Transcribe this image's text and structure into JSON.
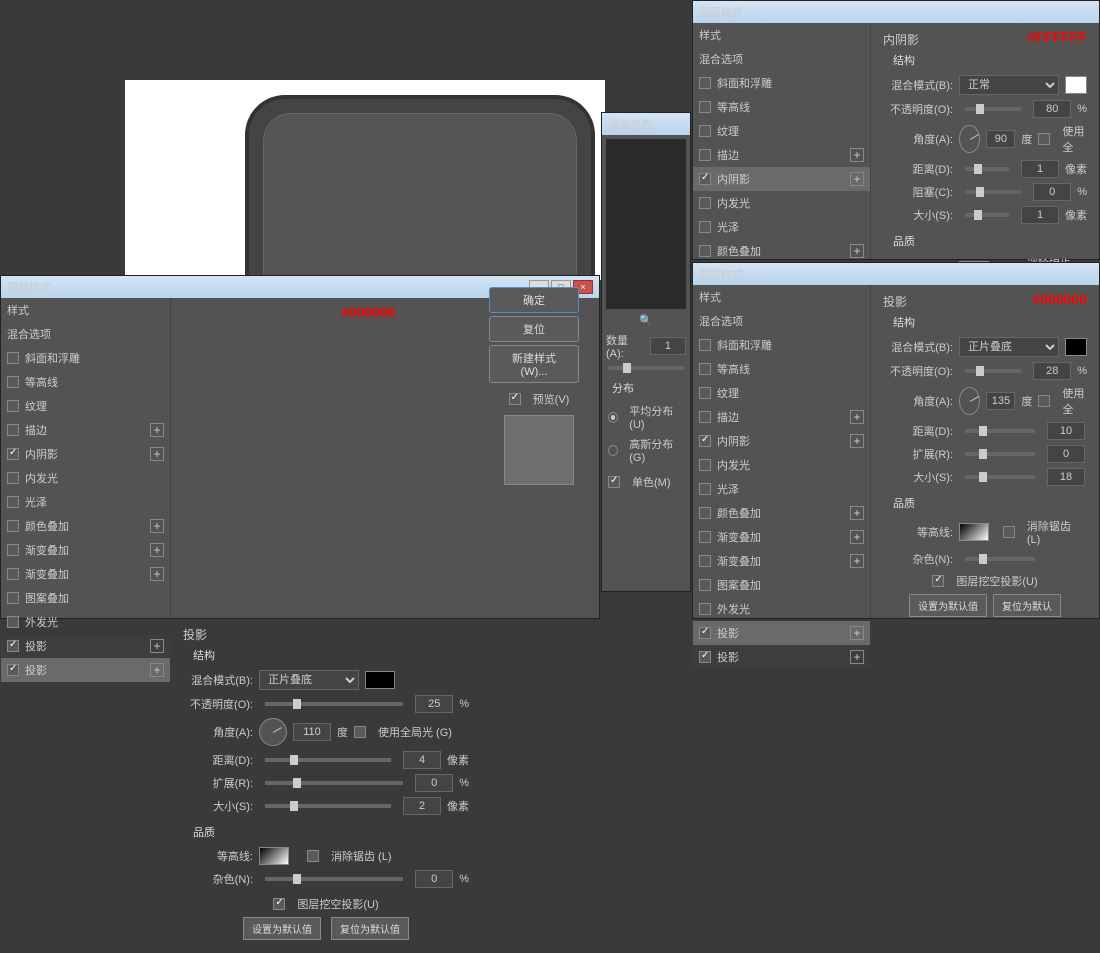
{
  "dialogTitle": "图层样式",
  "addColor": {
    "title": "添加杂色",
    "qty": "数量(A):",
    "qtyVal": "1",
    "dist": "分布",
    "even": "平均分布(U)",
    "gauss": "高斯分布(G)",
    "mono": "单色(M)"
  },
  "styles": {
    "header": "样式",
    "blend": "混合选项",
    "bevel": "斜面和浮雕",
    "contourRow": "等高线",
    "texture": "纹理",
    "stroke": "描边",
    "innerShadow": "内阴影",
    "innerGlow": "内发光",
    "satin": "光泽",
    "colorOverlay": "颜色叠加",
    "gradOverlay": "渐变叠加",
    "patOverlay": "图案叠加",
    "outerGlow": "外发光",
    "dropShadow": "投影",
    "dropShadow2": "投影"
  },
  "struct": {
    "title": "结构",
    "blendMode": "混合模式(B):",
    "multiply": "正片叠底",
    "normal": "正常",
    "opacity": "不透明度(O):",
    "angle": "角度(A):",
    "deg": "度",
    "useGlobal": "使用全局光 (G)",
    "useGlobalShort": "使用全",
    "distance": "距离(D):",
    "spread": "扩展(R):",
    "choke": "阻塞(C):",
    "size": "大小(S):",
    "px": "像素",
    "pct": "%"
  },
  "quality": {
    "title": "品质",
    "contour": "等高线:",
    "anti": "消除锯齿 (L)",
    "noise": "杂色(N):"
  },
  "knockout": "图层挖空投影(U)",
  "defaults": {
    "set": "设置为默认值",
    "reset": "复位为默认值",
    "resetShort": "复位为默认"
  },
  "btns": {
    "ok": "确定",
    "cancel": "复位",
    "newStyle": "新建样式 (W)...",
    "preview": "预览(V)"
  },
  "vals": {
    "left": {
      "title": "投影",
      "annot": "#000000",
      "opacity": "25",
      "angle": "110",
      "dist": "4",
      "spread": "0",
      "size": "2",
      "noise": "0"
    },
    "right1": {
      "title": "内阴影",
      "annot": "#FFFFFF",
      "opacity": "80",
      "angle": "90",
      "dist": "1",
      "choke": "0",
      "size": "1"
    },
    "right2": {
      "title": "投影",
      "annot": "#000000",
      "opacity": "28",
      "angle": "135",
      "dist": "10",
      "spread": "0",
      "size": "18"
    }
  },
  "magnify": "magnifier-icon"
}
